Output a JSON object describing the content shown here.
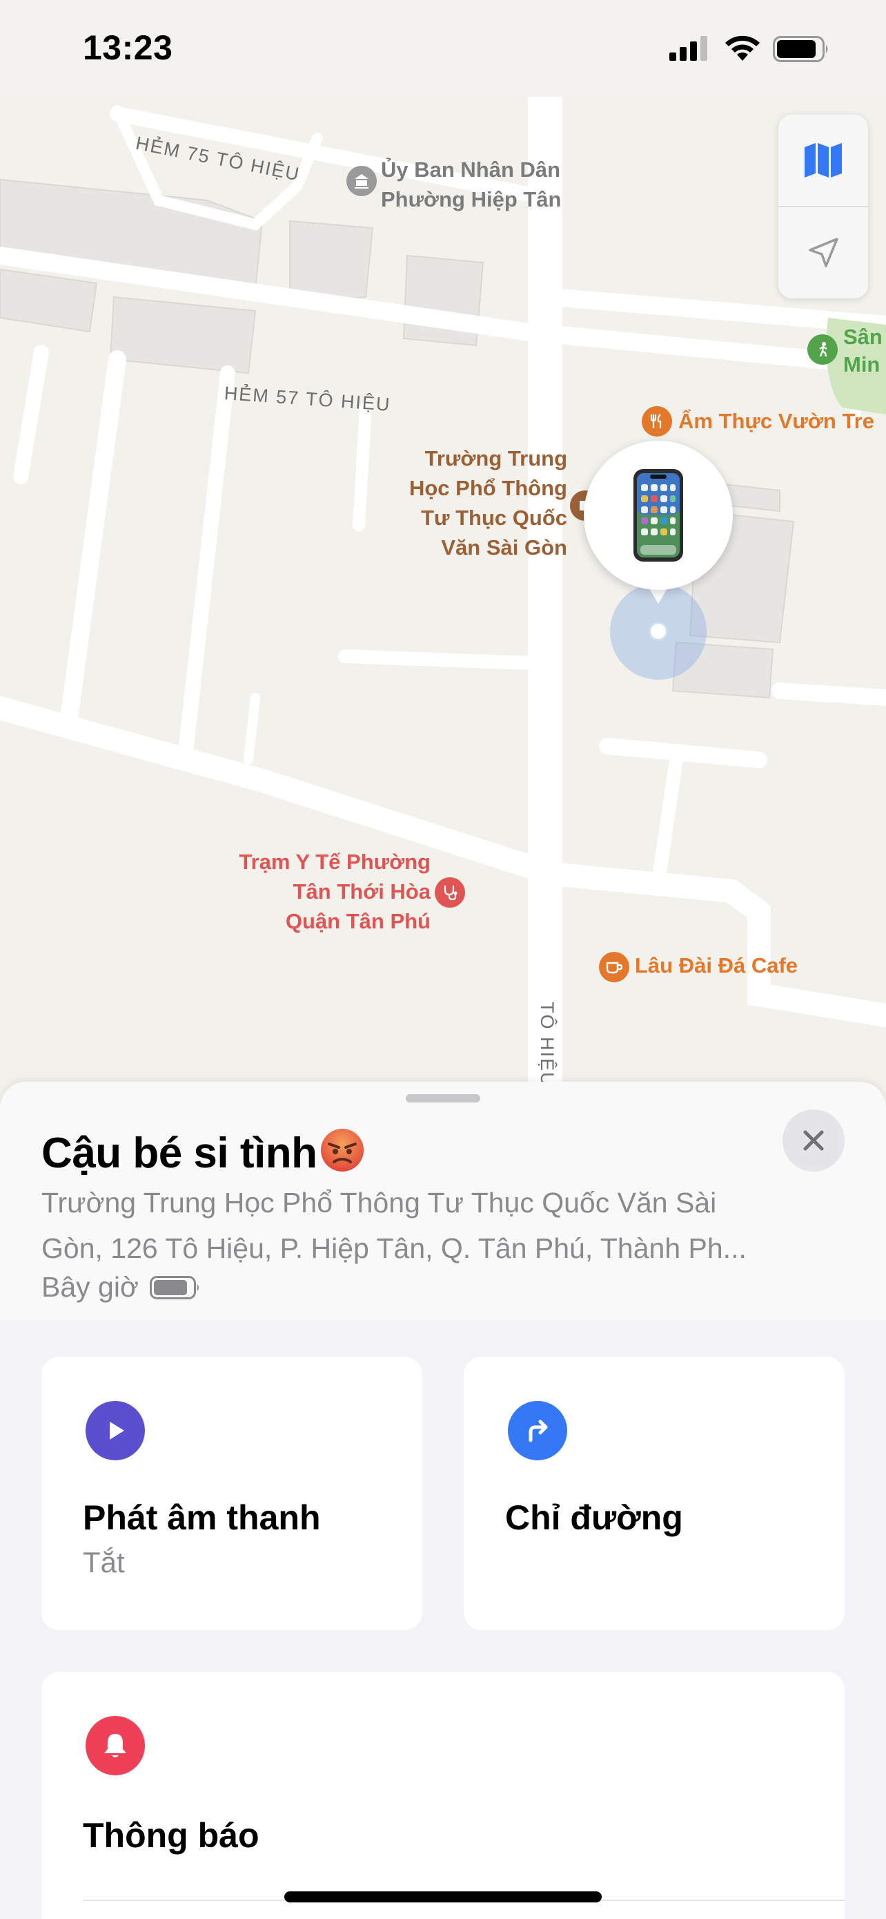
{
  "status_bar": {
    "time": "13:23",
    "icons": [
      "cellular-signal-icon",
      "wifi-icon",
      "battery-icon"
    ]
  },
  "map": {
    "streets": [
      "HẺM 75 TÔ HIỆU",
      "HẺM 57 TÔ HIỆU",
      "TÔ HIỆU"
    ],
    "pois": {
      "ubnd": [
        "Ủy Ban Nhân Dân",
        "Phường Hiệp Tân"
      ],
      "school": [
        "Trường Trung",
        "Học Phổ Thông",
        "Tư Thục Quốc",
        "Văn Sài Gòn"
      ],
      "restaurant": "Ẩm Thực Vườn Tre",
      "park": [
        "Sân",
        "Min"
      ],
      "clinic": [
        "Trạm Y Tế Phường",
        "Tân Thới Hòa",
        "Quận Tân Phú"
      ],
      "cafe": "Lâu Đài Đá Cafe"
    },
    "controls": [
      "map-icon",
      "location-arrow-icon"
    ],
    "device_pin_icon": "iphone-icon"
  },
  "sheet": {
    "device_name": "Cậu bé si tình",
    "emoji": "angry-face-icon",
    "address_lines": [
      "Trường Trung Học Phổ Thông Tư Thục Quốc Văn Sài",
      "Gòn, 126 Tô Hiệu, P. Hiệp Tân, Q. Tân Phú, Thành Ph..."
    ],
    "updated": "Bây giờ",
    "close_icon": "close-icon"
  },
  "actions": {
    "play_sound": {
      "title": "Phát âm thanh",
      "subtitle": "Tắt",
      "icon": "play-icon",
      "color": "#5a4fcf"
    },
    "directions": {
      "title": "Chỉ đường",
      "icon": "turn-right-arrow-icon",
      "color": "#3478f6"
    },
    "notifications": {
      "title": "Thông báo",
      "icon": "bell-icon",
      "color": "#ee4056"
    }
  }
}
